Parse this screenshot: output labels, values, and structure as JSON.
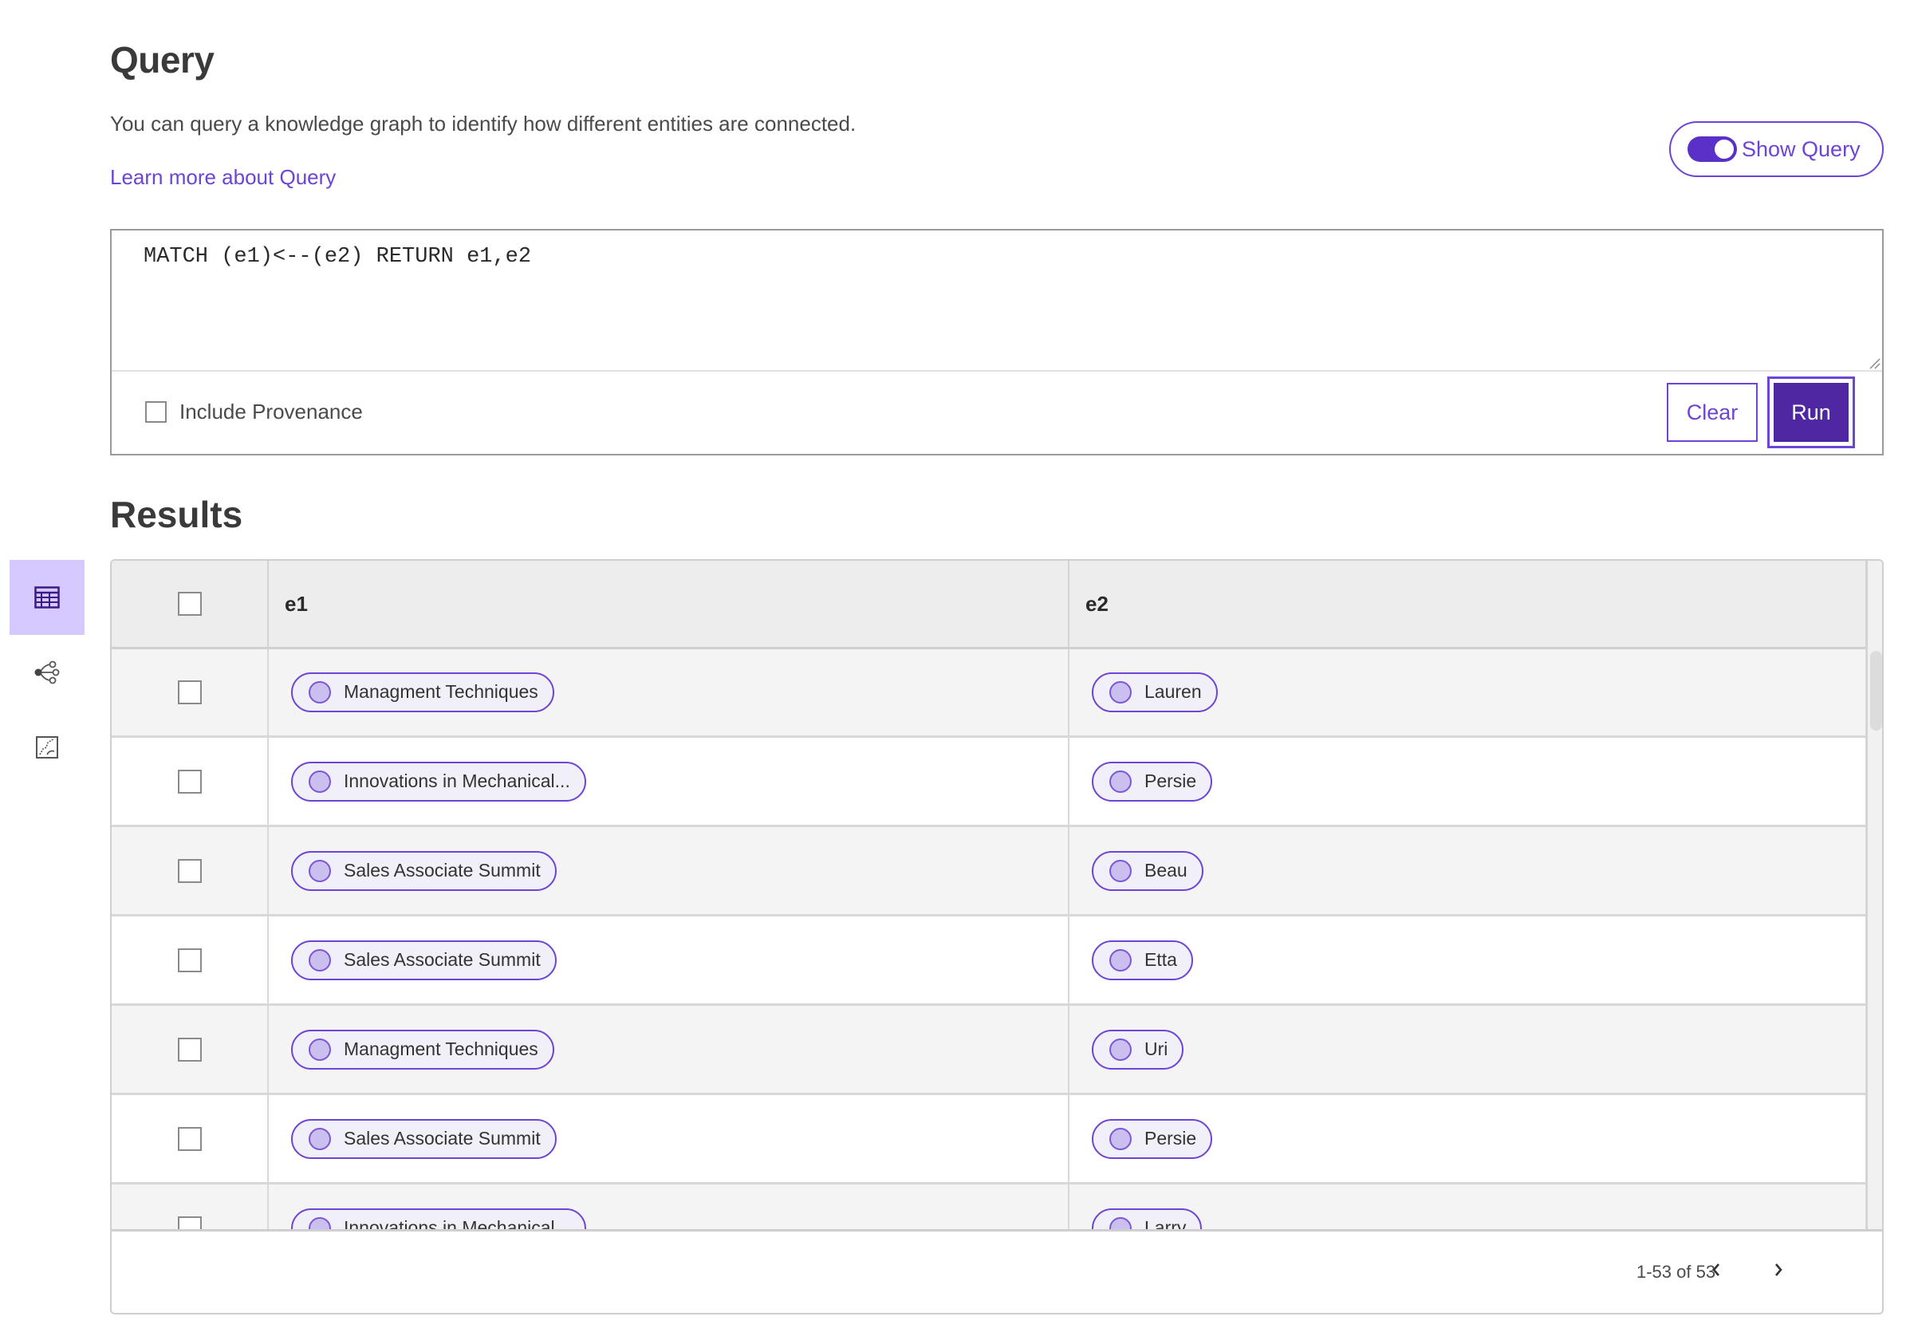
{
  "sidebar": {
    "items": [
      {
        "name": "table-view",
        "icon": "table-icon",
        "active": true
      },
      {
        "name": "graph-view",
        "icon": "graph-nodes-icon",
        "active": false
      },
      {
        "name": "chart-view",
        "icon": "scatter-chart-icon",
        "active": false
      }
    ]
  },
  "header": {
    "title": "Query",
    "description": "You can query a knowledge graph to identify how different entities are connected.",
    "learn_more": "Learn more about Query",
    "show_query_label": "Show Query",
    "show_query_on": true
  },
  "query": {
    "text": "MATCH (e1)<--(e2) RETURN e1,e2",
    "include_provenance_label": "Include Provenance",
    "include_provenance_checked": false,
    "clear_label": "Clear",
    "run_label": "Run"
  },
  "results": {
    "title": "Results",
    "columns": [
      "e1",
      "e2"
    ],
    "rows": [
      {
        "e1": "Managment Techniques",
        "e2": "Lauren"
      },
      {
        "e1": "Innovations in Mechanical...",
        "e2": "Persie"
      },
      {
        "e1": "Sales Associate Summit",
        "e2": "Beau"
      },
      {
        "e1": "Sales Associate Summit",
        "e2": "Etta"
      },
      {
        "e1": "Managment Techniques",
        "e2": "Uri"
      },
      {
        "e1": "Sales Associate Summit",
        "e2": "Persie"
      },
      {
        "e1": "Innovations in Mechanical...",
        "e2": "Larry"
      }
    ],
    "pagination": {
      "label": "1-53 of 53",
      "prev_icon": "chevron-left-icon",
      "next_icon": "chevron-right-icon"
    }
  },
  "colors": {
    "accent": "#6c44d6",
    "primary_button": "#4f27a3",
    "sidebar_active": "#d6c9ff",
    "pill_fill": "#f1f0f8",
    "pill_dot": "#cbbff0"
  }
}
